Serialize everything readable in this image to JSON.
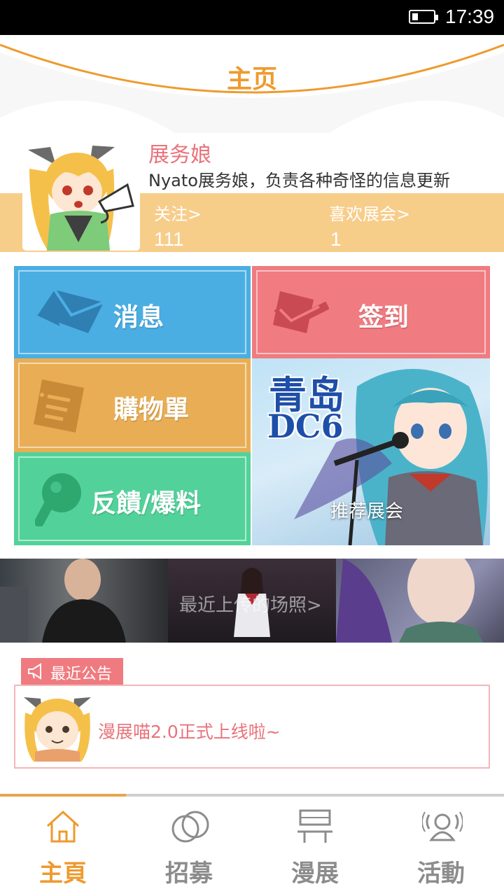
{
  "status_bar": {
    "time": "17:39"
  },
  "header": {
    "title": "主页"
  },
  "profile": {
    "name": "展务娘",
    "description": "Nyato展务娘，负责各种奇怪的信息更新",
    "stats": [
      {
        "label": "关注>",
        "value": "111"
      },
      {
        "label": "喜欢展会>",
        "value": "1"
      }
    ]
  },
  "tiles": {
    "message": "消息",
    "checkin": "签到",
    "shopping": "購物單",
    "feedback": "反饋/爆料"
  },
  "featured": {
    "title_line1": "青岛",
    "title_line2": "DC6",
    "caption": "推荐展会"
  },
  "photos": {
    "caption": "最近上传的场照>"
  },
  "notice": {
    "tag": "最近公告",
    "text": "漫展喵2.0正式上线啦~"
  },
  "tabs": [
    {
      "label": "主頁",
      "icon": "home-icon",
      "active": true
    },
    {
      "label": "招募",
      "icon": "rings-icon",
      "active": false
    },
    {
      "label": "漫展",
      "icon": "booth-icon",
      "active": false
    },
    {
      "label": "活動",
      "icon": "person-broadcast-icon",
      "active": false
    }
  ],
  "colors": {
    "accent": "#ef9a2e",
    "profile_band": "#f7cd8a",
    "message_tile": "#4aaee3",
    "checkin_tile": "#f07b80",
    "shopping_tile": "#e9ae55",
    "feedback_tile": "#52d29a",
    "notice": "#ef7b80",
    "tab_inactive": "#8c8c8c"
  }
}
